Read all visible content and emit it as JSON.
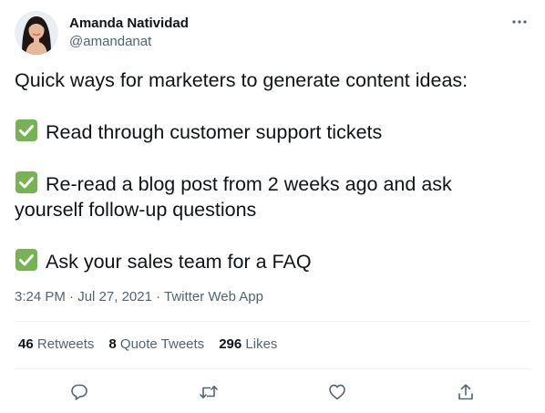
{
  "author": {
    "name": "Amanda Natividad",
    "handle": "@amandanat"
  },
  "tweet": {
    "intro": "Quick ways for marketers to generate content ideas:",
    "items": [
      {
        "icon": "check-mark-button-icon",
        "line1": "Read through customer support tickets",
        "line2": ""
      },
      {
        "icon": "check-mark-button-icon",
        "line1": "Re-read a blog post from 2 weeks ago and ask",
        "line2": "yourself follow-up questions"
      },
      {
        "icon": "check-mark-button-icon",
        "line1": "Ask your sales team for a FAQ",
        "line2": ""
      }
    ],
    "time": "3:24 PM",
    "separator": " · ",
    "date": "Jul 27, 2021",
    "source": "Twitter Web App"
  },
  "stats": {
    "retweets": {
      "count": "46",
      "label": "Retweets"
    },
    "quotes": {
      "count": "8",
      "label": "Quote Tweets"
    },
    "likes": {
      "count": "296",
      "label": "Likes"
    }
  },
  "colors": {
    "text": "#0f1419",
    "secondary": "#536471",
    "divider": "#eff3f4",
    "check_green": "#77b255"
  }
}
